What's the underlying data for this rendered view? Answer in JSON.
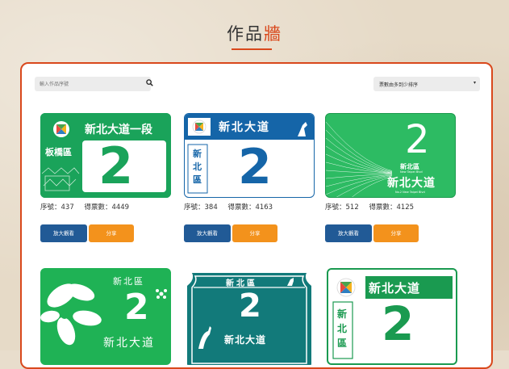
{
  "page": {
    "title_main": "作品",
    "title_accent": "牆"
  },
  "search": {
    "placeholder": "輸入作品序號"
  },
  "sort": {
    "selected": "票數由多到少排序"
  },
  "cards": [
    {
      "seq_label": "序號：437",
      "votes_label": "得票數：4449",
      "view_label": "放大觀看",
      "share_label": "分享",
      "plate": {
        "road": "新北大道一段",
        "district": "板橋區",
        "number": "2"
      }
    },
    {
      "seq_label": "序號：384",
      "votes_label": "得票數：4163",
      "view_label": "放大觀看",
      "share_label": "分享",
      "plate": {
        "road": "新北大道",
        "district_chars": [
          "新",
          "北",
          "區"
        ],
        "number": "2"
      }
    },
    {
      "seq_label": "序號：512",
      "votes_label": "得票數：4125",
      "view_label": "放大觀看",
      "share_label": "分享",
      "plate": {
        "number": "2",
        "district": "新北區",
        "english": "New Taipei Blvd",
        "road": "新北大道",
        "english2": "No.2 New Taipei Blvd"
      }
    },
    {
      "plate": {
        "district": "新北區",
        "number": "2",
        "road": "新北大道"
      }
    },
    {
      "plate": {
        "district": "新北區",
        "number": "2",
        "road": "新北大道"
      }
    },
    {
      "plate": {
        "road": "新北大道",
        "district_chars": [
          "新",
          "北",
          "區"
        ],
        "number": "2"
      }
    }
  ],
  "colors": {
    "accent": "#d9481c",
    "view_button": "#215a96",
    "share_button": "#f3921c",
    "plate_green": "#1aa35a",
    "plate_blue": "#1565a8",
    "plate_teal": "#127a7a"
  }
}
